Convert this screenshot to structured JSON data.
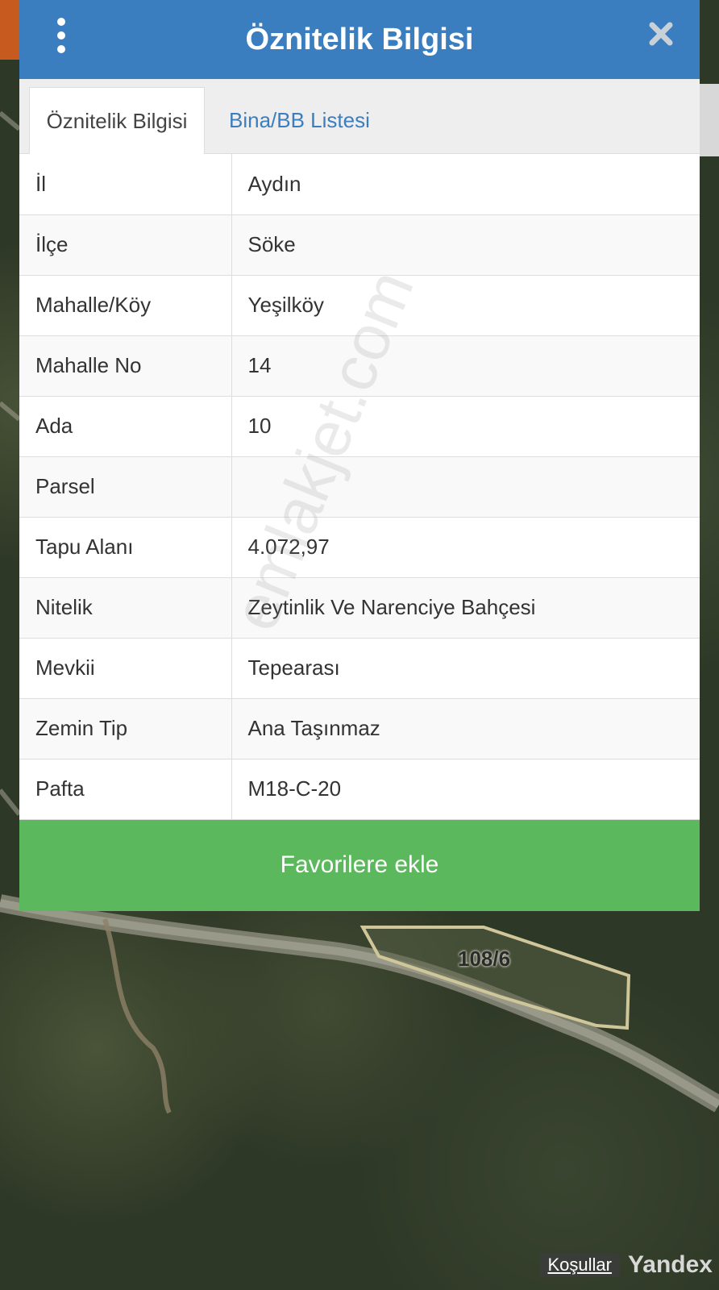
{
  "dialog": {
    "title": "Öznitelik Bilgisi",
    "tabs": [
      {
        "label": "Öznitelik Bilgisi",
        "active": true
      },
      {
        "label": "Bina/BB Listesi",
        "active": false
      }
    ],
    "rows": [
      {
        "key": "İl",
        "value": "Aydın"
      },
      {
        "key": "İlçe",
        "value": "Söke"
      },
      {
        "key": "Mahalle/Köy",
        "value": "Yeşilköy"
      },
      {
        "key": "Mahalle No",
        "value": "14"
      },
      {
        "key": "Ada",
        "value": "10"
      },
      {
        "key": "Parsel",
        "value": ""
      },
      {
        "key": "Tapu Alanı",
        "value": "4.072,97"
      },
      {
        "key": "Nitelik",
        "value": "Zeytinlik Ve Narenciye Bahçesi"
      },
      {
        "key": "Mevkii",
        "value": "Tepearası"
      },
      {
        "key": "Zemin Tip",
        "value": "Ana Taşınmaz"
      },
      {
        "key": "Pafta",
        "value": "M18-C-20"
      }
    ],
    "favorite_label": "Favorilere ekle",
    "colors": {
      "header": "#3a7ec0",
      "favorite": "#5cb85c"
    }
  },
  "map": {
    "parcel_label": "108/6",
    "terms_label": "Koşullar",
    "provider": "Yandex"
  },
  "watermark": "emlakjet.com"
}
